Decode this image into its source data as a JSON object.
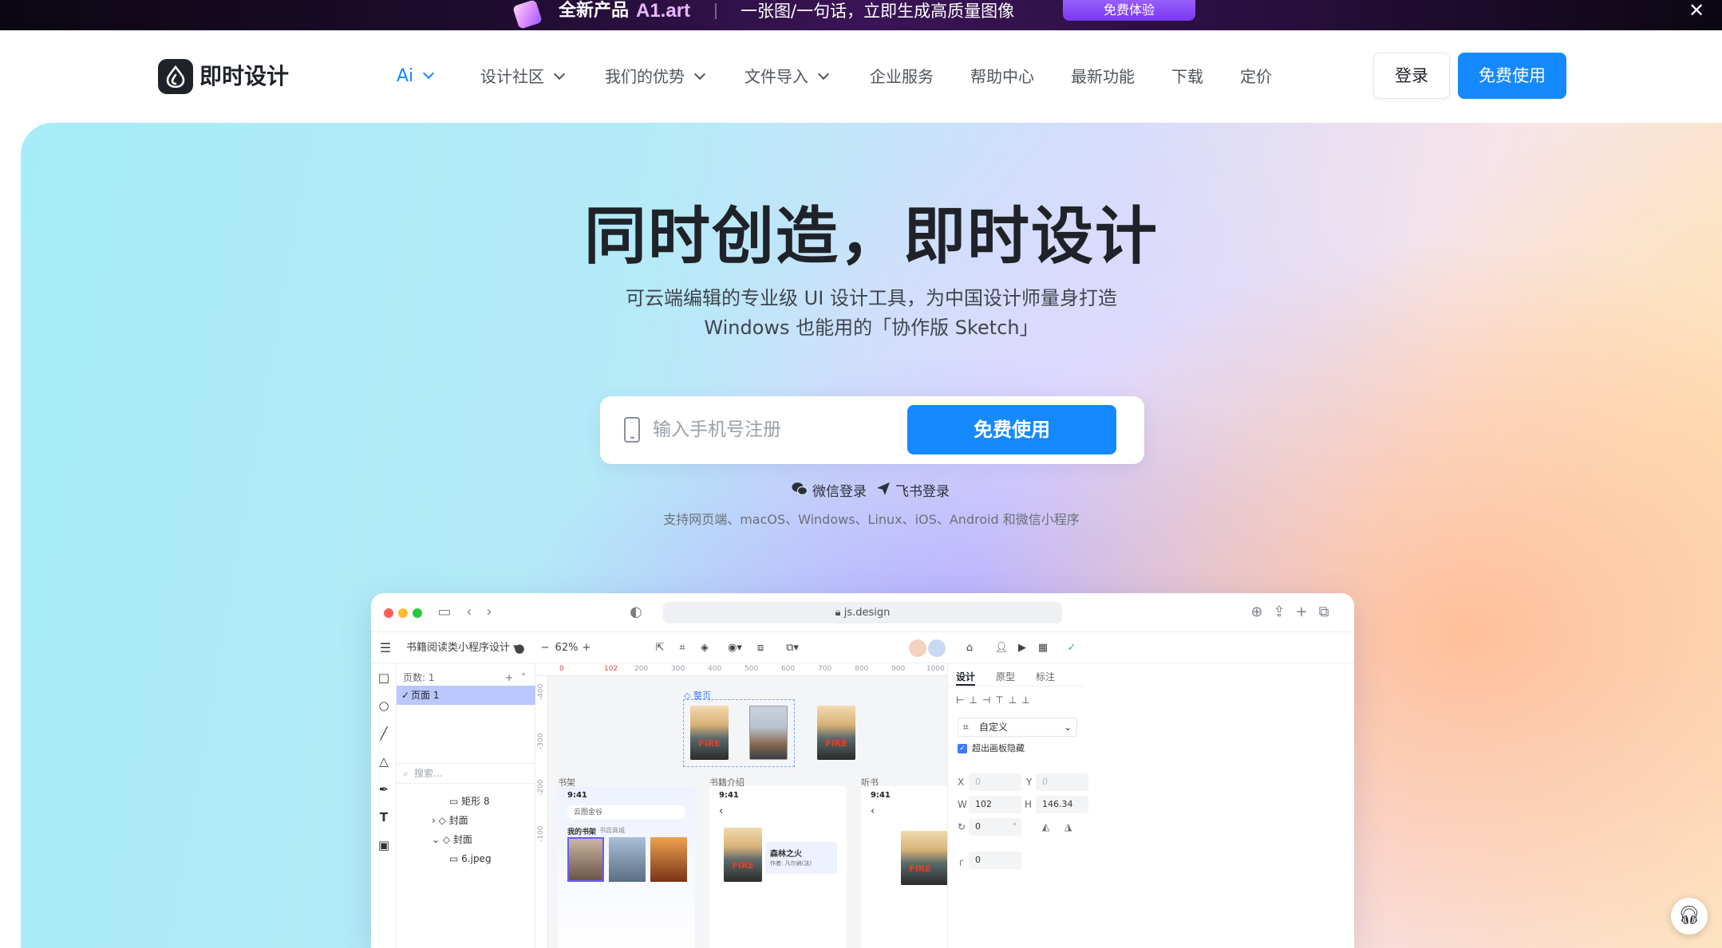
{
  "banner": {
    "new_label": "全新产品",
    "brand": "A1.art",
    "slogan": "一张图/一句话，立即生成高质量图像",
    "cta": "免费体验",
    "close": "✕"
  },
  "header": {
    "logo_text": "即时设计",
    "nav": [
      {
        "label": "Ai",
        "has_menu": true
      },
      {
        "label": "设计社区",
        "has_menu": true
      },
      {
        "label": "我们的优势",
        "has_menu": true
      },
      {
        "label": "文件导入",
        "has_menu": true
      },
      {
        "label": "企业服务",
        "has_menu": false
      },
      {
        "label": "帮助中心",
        "has_menu": false
      },
      {
        "label": "最新功能",
        "has_menu": false
      },
      {
        "label": "下载",
        "has_menu": false
      },
      {
        "label": "定价",
        "has_menu": false
      }
    ],
    "login": "登录",
    "free_use": "免费使用"
  },
  "hero": {
    "title": "同时创造，即时设计",
    "subtitle_line1": "可云端编辑的专业级 UI 设计工具，为中国设计师量身打造",
    "subtitle_line2": "Windows 也能用的「协作版 Sketch」",
    "phone_placeholder": "输入手机号注册",
    "signup_button": "免费使用",
    "wechat_login": "微信登录",
    "feishu_login": "飞书登录",
    "platforms": "支持网页端、macOS、Windows、Linux、iOS、Android 和微信小程序"
  },
  "app": {
    "url": "js.design",
    "file_name": "书籍阅读类小程序设计",
    "zoom": "62%",
    "pages_header": "页数: 1",
    "page_1": "页面 1",
    "search_placeholder": "搜索...",
    "layers": [
      "矩形 8",
      "封面",
      "封面",
      "6.jpeg"
    ],
    "ruler_top": [
      "0",
      "102",
      "200",
      "300",
      "400",
      "500",
      "600",
      "700",
      "800",
      "900",
      "1000"
    ],
    "ruler_left": [
      "-400",
      "-300",
      "-200",
      "-100"
    ],
    "frame_group": "整页",
    "frames": [
      "书架",
      "书籍介绍",
      "听书"
    ],
    "frame_time": "9:41",
    "shelf_search": "云图金谷",
    "shelf_tab_1": "我的书架",
    "shelf_tab_2": "书店商城",
    "book_title": "森林之火",
    "book_author": "作者: 凡尔纳(法)",
    "inspector_tabs": [
      "设计",
      "原型",
      "标注"
    ],
    "preset": "自定义",
    "clip_content": "超出画板隐藏",
    "x": "0",
    "y": "0",
    "w": "102",
    "h": "146.34",
    "rotation": "0",
    "rotation_unit": "°",
    "radius": "0",
    "labels": {
      "x": "X",
      "y": "Y",
      "w": "W",
      "h": "H"
    }
  },
  "colors": {
    "accent": "#1589ff",
    "text_dark": "#1f2329",
    "nav_text": "#50555e"
  }
}
